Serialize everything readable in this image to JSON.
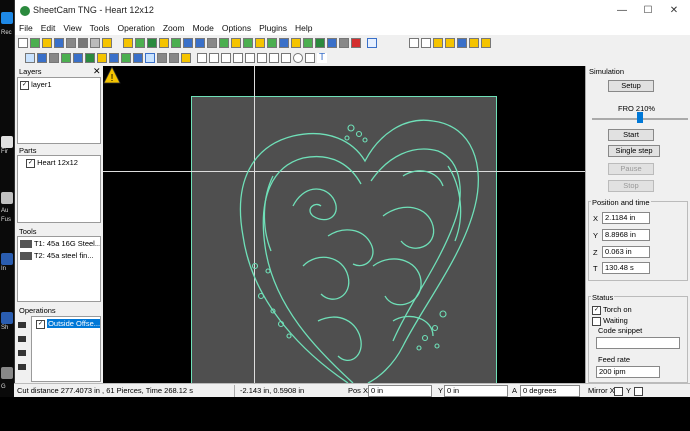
{
  "desktop": {
    "labels": [
      "Rec",
      "Fir",
      "Au",
      "Fus",
      "In",
      "Sh",
      "G"
    ]
  },
  "window": {
    "title": "SheetCam TNG - Heart 12x12",
    "controls": {
      "minimize": "—",
      "maximize": "☐",
      "close": "✕"
    }
  },
  "menu": [
    "File",
    "Edit",
    "View",
    "Tools",
    "Operation",
    "Zoom",
    "Mode",
    "Options",
    "Plugins",
    "Help"
  ],
  "panels": {
    "layers": {
      "title": "Layers",
      "items": [
        "layer1"
      ]
    },
    "parts": {
      "title": "Parts",
      "items": [
        "Heart 12x12"
      ]
    },
    "tools": {
      "title": "Tools",
      "items": [
        "T1: 45a 16G Steel...",
        "T2: 45a  steel fin..."
      ]
    },
    "operations": {
      "title": "Operations",
      "items": [
        "Outside Offse..."
      ]
    }
  },
  "simulation": {
    "title": "Simulation",
    "setup": "Setup",
    "fro": "FRO 210%",
    "fro_level": 0.5,
    "start": "Start",
    "single_step": "Single step",
    "pause": "Pause",
    "stop": "Stop",
    "position_title": "Position and time",
    "x_label": "X",
    "x_value": "2.1184 in",
    "y_label": "Y",
    "y_value": "8.8968 in",
    "z_label": "Z",
    "z_value": "0.063 in",
    "t_label": "T",
    "t_value": "130.48 s",
    "status_title": "Status",
    "torch_on": "Torch on",
    "waiting": "Waiting",
    "code_snippet": "Code snippet",
    "feed_rate": "Feed rate",
    "feed_value": "200 ipm"
  },
  "statusbar": {
    "cut_info": "Cut distance 277.4073 in , 61 Pierces, Time 268.12 s",
    "cursor": "-2.143 in, 0.5908 in",
    "posx_label": "Pos X",
    "posx_value": "0 in",
    "y_label": "Y",
    "y_value": "0 in",
    "a_label": "A",
    "a_value": "0 degrees",
    "mirrorx_label": "Mirror X",
    "y2_label": "Y"
  },
  "colors": {
    "path": "#6fe0b8",
    "sheet": "#4f4f4f",
    "warning": "#f5c400",
    "selection": "#0078d7"
  }
}
